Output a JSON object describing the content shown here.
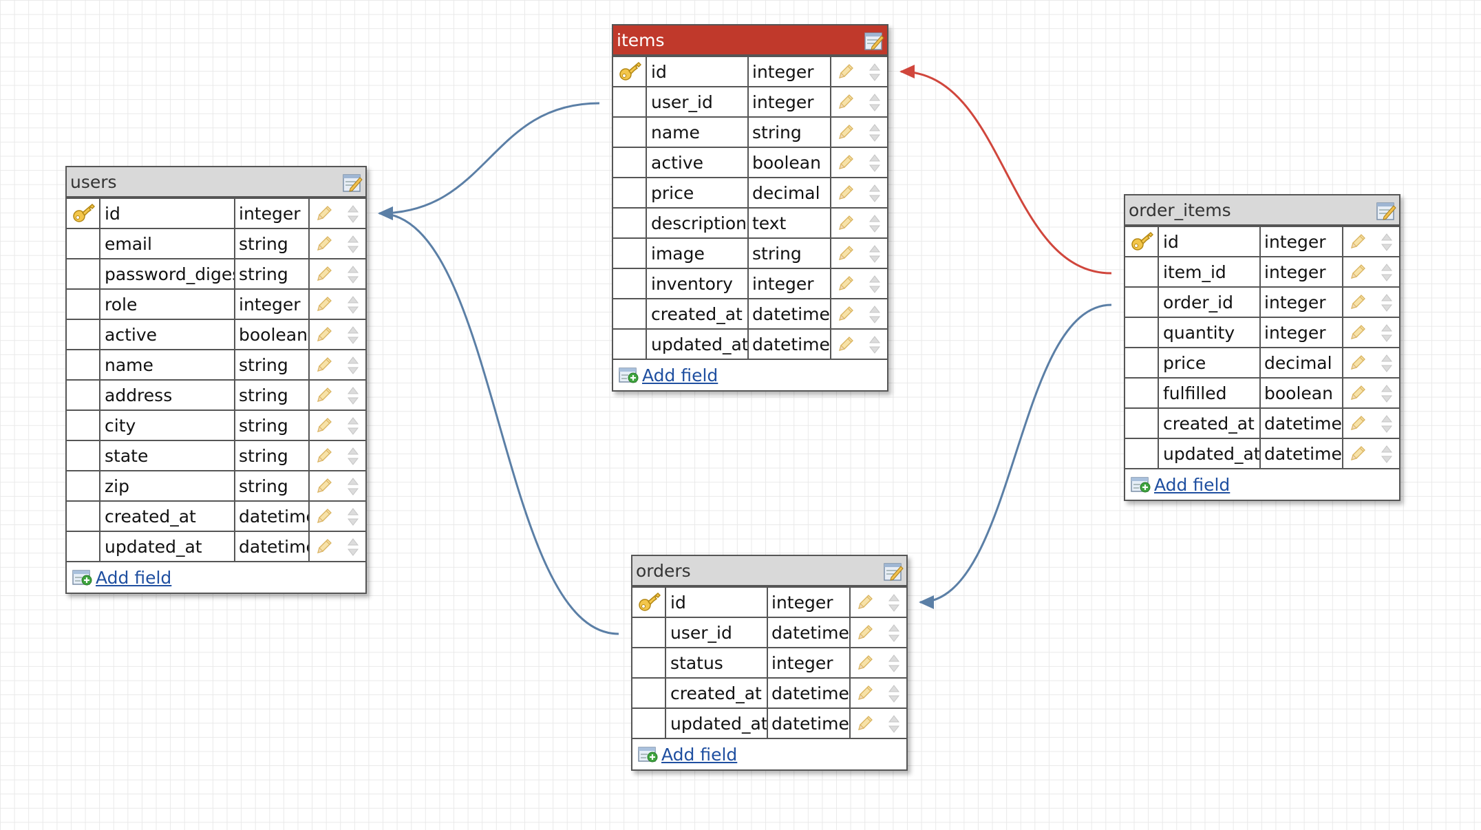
{
  "colors": {
    "selected_header": "#c0392b",
    "relation_default": "#5b7fa6",
    "relation_selected": "#d0463c",
    "link": "#1f4fa0"
  },
  "icons": {
    "primary_key": "key-icon",
    "edit_table": "edit-table-icon",
    "edit_field": "pencil-icon",
    "reorder_field": "move-handle-icon",
    "add_field": "add-field-icon"
  },
  "add_field_label": "Add field",
  "tables": [
    {
      "id": "users",
      "name": "users",
      "selected": false,
      "fields": [
        {
          "name": "id",
          "type": "integer",
          "primary": true
        },
        {
          "name": "email",
          "type": "string"
        },
        {
          "name": "password_digest",
          "type": "string"
        },
        {
          "name": "role",
          "type": "integer"
        },
        {
          "name": "active",
          "type": "boolean"
        },
        {
          "name": "name",
          "type": "string"
        },
        {
          "name": "address",
          "type": "string"
        },
        {
          "name": "city",
          "type": "string"
        },
        {
          "name": "state",
          "type": "string"
        },
        {
          "name": "zip",
          "type": "string"
        },
        {
          "name": "created_at",
          "type": "datetime"
        },
        {
          "name": "updated_at",
          "type": "datetime"
        }
      ]
    },
    {
      "id": "items",
      "name": "items",
      "selected": true,
      "fields": [
        {
          "name": "id",
          "type": "integer",
          "primary": true
        },
        {
          "name": "user_id",
          "type": "integer"
        },
        {
          "name": "name",
          "type": "string"
        },
        {
          "name": "active",
          "type": "boolean"
        },
        {
          "name": "price",
          "type": "decimal"
        },
        {
          "name": "description",
          "type": "text"
        },
        {
          "name": "image",
          "type": "string"
        },
        {
          "name": "inventory",
          "type": "integer"
        },
        {
          "name": "created_at",
          "type": "datetime"
        },
        {
          "name": "updated_at",
          "type": "datetime"
        }
      ]
    },
    {
      "id": "order_items",
      "name": "order_items",
      "selected": false,
      "fields": [
        {
          "name": "id",
          "type": "integer",
          "primary": true
        },
        {
          "name": "item_id",
          "type": "integer"
        },
        {
          "name": "order_id",
          "type": "integer"
        },
        {
          "name": "quantity",
          "type": "integer"
        },
        {
          "name": "price",
          "type": "decimal"
        },
        {
          "name": "fulfilled",
          "type": "boolean"
        },
        {
          "name": "created_at",
          "type": "datetime"
        },
        {
          "name": "updated_at",
          "type": "datetime"
        }
      ]
    },
    {
      "id": "orders",
      "name": "orders",
      "selected": false,
      "fields": [
        {
          "name": "id",
          "type": "integer",
          "primary": true
        },
        {
          "name": "user_id",
          "type": "datetime"
        },
        {
          "name": "status",
          "type": "integer"
        },
        {
          "name": "created_at",
          "type": "datetime"
        },
        {
          "name": "updated_at",
          "type": "datetime"
        }
      ]
    }
  ],
  "relations": [
    {
      "from_table": "items",
      "from_field": "user_id",
      "to_table": "users",
      "to_field": "id",
      "highlighted": false
    },
    {
      "from_table": "orders",
      "from_field": "user_id",
      "to_table": "users",
      "to_field": "id",
      "highlighted": false
    },
    {
      "from_table": "order_items",
      "from_field": "item_id",
      "to_table": "items",
      "to_field": "id",
      "highlighted": true
    },
    {
      "from_table": "order_items",
      "from_field": "order_id",
      "to_table": "orders",
      "to_field": "id",
      "highlighted": false
    }
  ]
}
